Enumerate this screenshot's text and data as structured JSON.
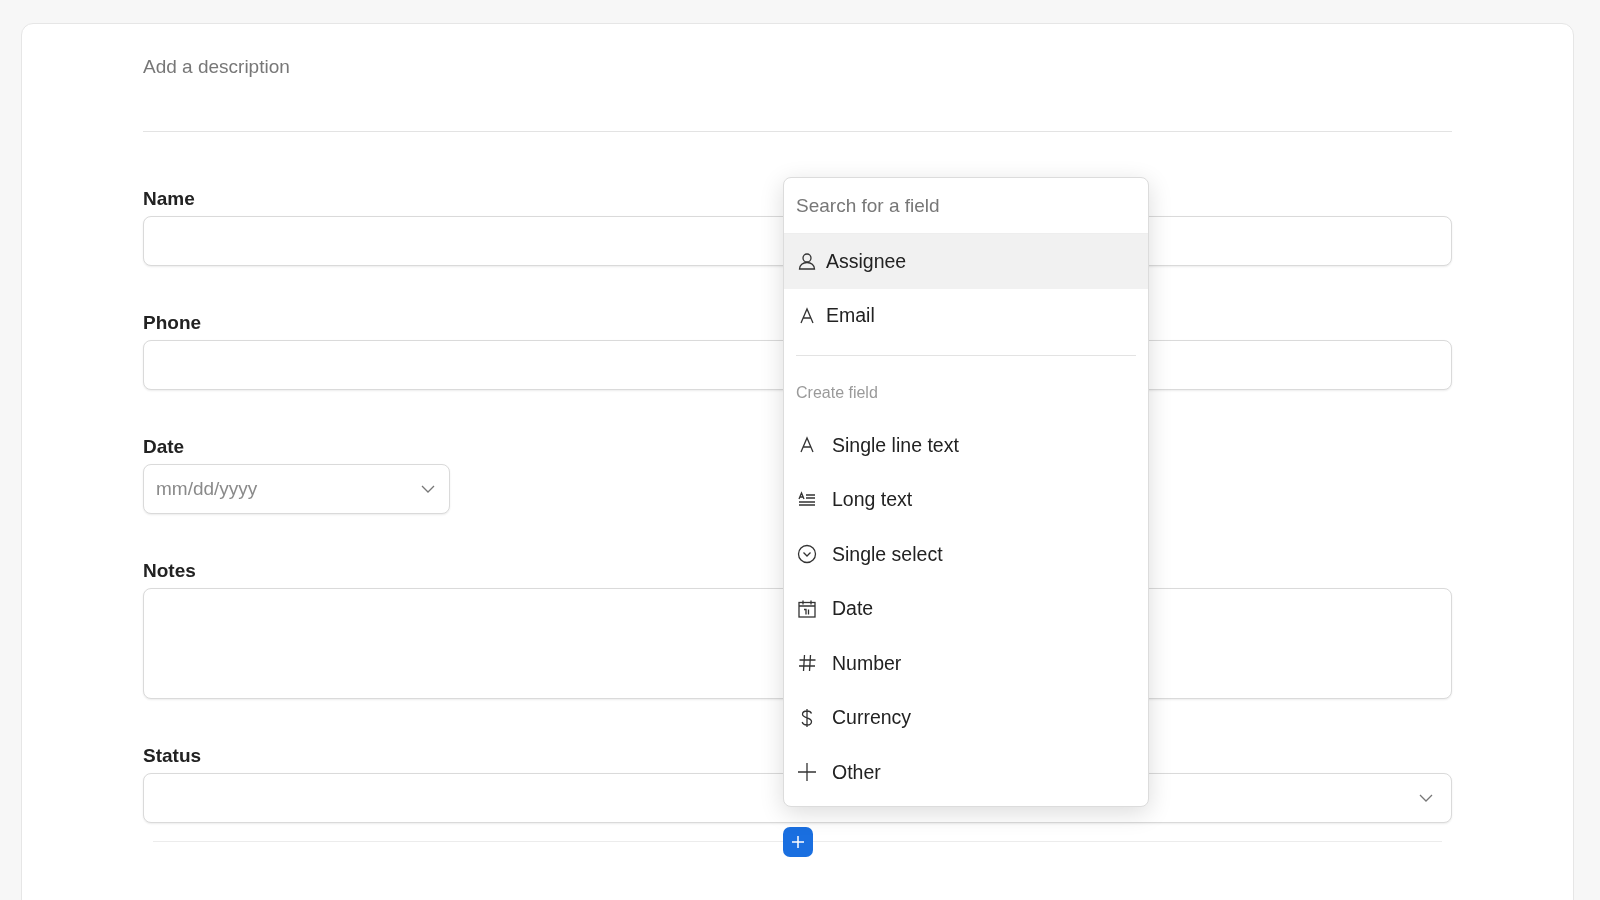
{
  "description": {
    "placeholder": "Add a description"
  },
  "fields": [
    {
      "label": "Name",
      "kind": "text"
    },
    {
      "label": "Phone",
      "kind": "text"
    },
    {
      "label": "Date",
      "kind": "date",
      "placeholder": "mm/dd/yyyy"
    },
    {
      "label": "Notes",
      "kind": "textarea"
    },
    {
      "label": "Status",
      "kind": "select"
    }
  ],
  "field_menu": {
    "search": {
      "placeholder": "Search for a field"
    },
    "existing_fields": [
      {
        "label": "Assignee",
        "kind": "person",
        "selected": true
      },
      {
        "label": "Email",
        "kind": "text",
        "selected": false
      }
    ],
    "section_label": "Create field",
    "create_options": [
      {
        "label": "Single line text",
        "kind": "text",
        "selected": false
      },
      {
        "label": "Long text",
        "kind": "long-text",
        "selected": false
      },
      {
        "label": "Single select",
        "kind": "select",
        "selected": false
      },
      {
        "label": "Date",
        "kind": "date",
        "selected": false
      },
      {
        "label": "Number",
        "kind": "number",
        "selected": false
      },
      {
        "label": "Currency",
        "kind": "currency",
        "selected": false
      },
      {
        "label": "Other",
        "kind": "other",
        "selected": false
      }
    ]
  }
}
